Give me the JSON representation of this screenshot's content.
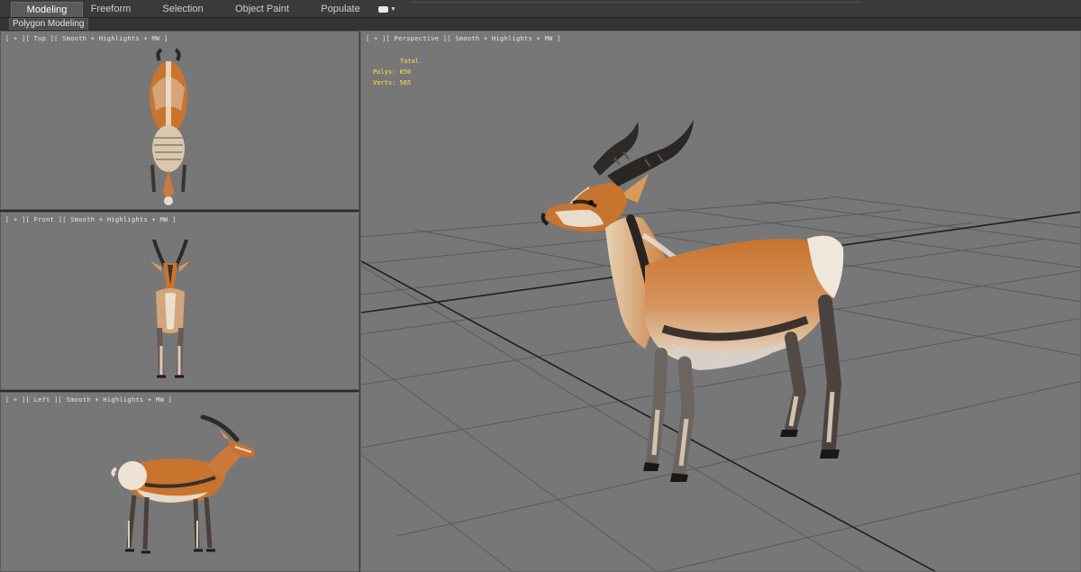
{
  "ribbon": {
    "tabs": [
      "Modeling",
      "Freeform",
      "Selection",
      "Object Paint",
      "Populate"
    ],
    "active_tab": "Modeling"
  },
  "subbar": {
    "label": "Polygon Modeling"
  },
  "viewports": {
    "top": {
      "label": "[ + ][ Top ][ Smooth + Highlights + MW ]"
    },
    "front": {
      "label": "[ + ][ Front ][ Smooth + Highlights + MW ]"
    },
    "left": {
      "label": "[ + ][ Left ][ Smooth + Highlights + MW ]"
    },
    "perspective": {
      "label": "[ + ][ Perspective ][ Smooth + Highlights + MW ]"
    }
  },
  "stats": {
    "title": "Total",
    "polys_label": "Polys:",
    "polys_value": "650",
    "verts_label": "Verts:",
    "verts_value": "565"
  },
  "colors": {
    "viewport_bg": "#777777",
    "grid_line": "#1e1e1e",
    "stats_text": "#ffe34a",
    "fur_orange": "#c8742e",
    "fur_cream": "#e8dccb",
    "horn": "#2e2a28"
  }
}
